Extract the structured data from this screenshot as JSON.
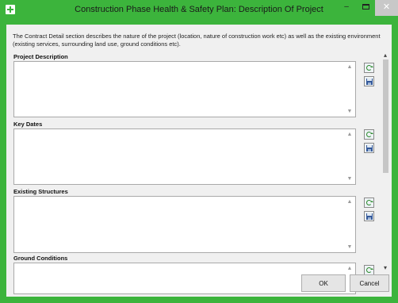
{
  "window": {
    "title": "Construction Phase Health & Safety Plan: Description Of Project",
    "minimize_glyph": "–",
    "close_glyph": "✕"
  },
  "intro_text": "The Contract Detail section describes the nature of the project (location, nature of construction work etc) as well as the existing environment (existing services, surrounding land use, ground conditions etc).",
  "sections": [
    {
      "label": "Project Description",
      "value": ""
    },
    {
      "label": "Key Dates",
      "value": ""
    },
    {
      "label": "Existing Structures",
      "value": ""
    },
    {
      "label": "Ground Conditions",
      "value": ""
    }
  ],
  "buttons": {
    "ok": "OK",
    "cancel": "Cancel"
  },
  "colors": {
    "frame": "#3cb43c",
    "client": "#f0f0f0",
    "button": "#e5e5e5"
  },
  "icons": [
    "app-plus-icon",
    "refresh-icon",
    "save-icon",
    "scroll-up-icon",
    "scroll-down-icon"
  ]
}
